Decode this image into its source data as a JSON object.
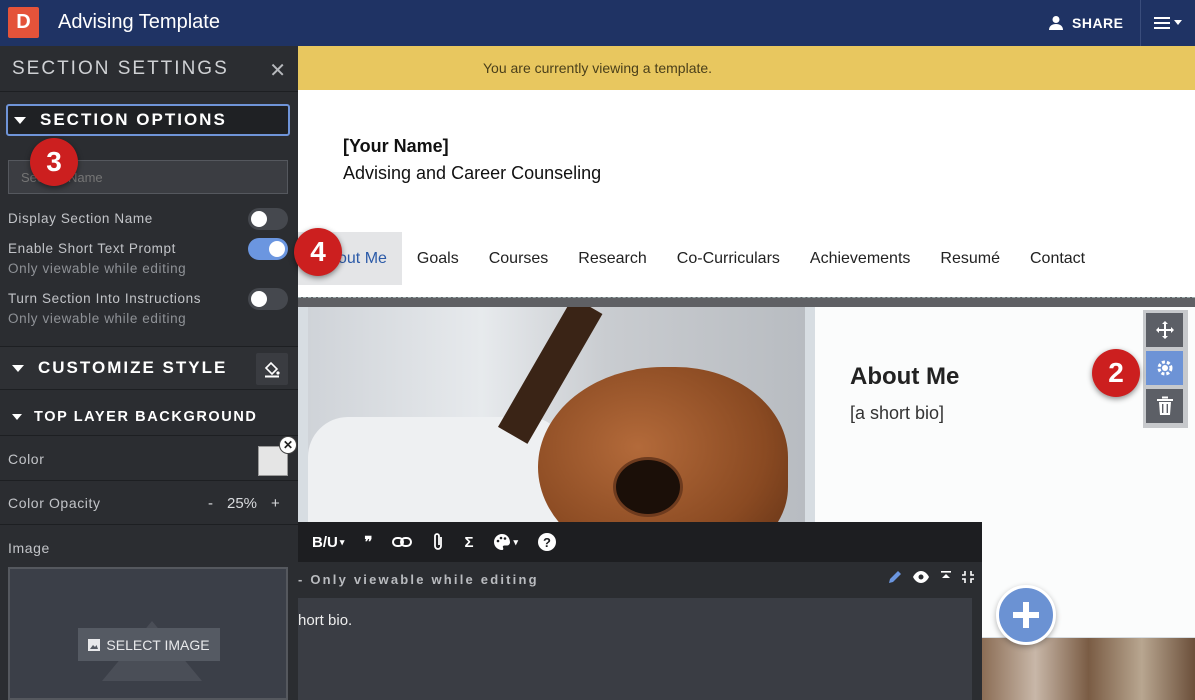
{
  "app": {
    "logo_letter": "D",
    "title": "Advising Template",
    "share_label": "SHARE"
  },
  "panel": {
    "header": "SECTION SETTINGS",
    "section_options": "SECTION OPTIONS",
    "section_name_placeholder": "Section Name",
    "options": [
      {
        "label": "Display Section Name",
        "sub": "",
        "on": false
      },
      {
        "label": "Enable Short Text Prompt",
        "sub": "Only viewable while editing",
        "on": true
      },
      {
        "label": "Turn Section Into Instructions",
        "sub": "Only viewable while editing",
        "on": false
      }
    ],
    "customize_style": "CUSTOMIZE STYLE",
    "top_layer_bg": "TOP LAYER BACKGROUND",
    "color_label": "Color",
    "opacity_label": "Color Opacity",
    "opacity_minus": "-",
    "opacity_value": "25%",
    "opacity_plus": "+",
    "image_label": "Image",
    "select_image": "SELECT IMAGE"
  },
  "banner": "You are currently viewing a template.",
  "site": {
    "name": "[Your Name]",
    "subtitle": "Advising and Career Counseling"
  },
  "nav": [
    "out Me",
    "Goals",
    "Courses",
    "Research",
    "Co-Curriculars",
    "Achievements",
    "Resumé",
    "Contact"
  ],
  "about": {
    "title": "About Me",
    "bio": "[a short bio]"
  },
  "editor": {
    "bold_underline": "B/U",
    "sigma": "Σ",
    "help": "?",
    "header_text": "- Only viewable while editing",
    "body_text": "hort bio."
  },
  "badges": {
    "two": "2",
    "three": "3",
    "four": "4"
  },
  "colors": {
    "topbar": "#1f3364",
    "accent": "#6b96e0",
    "banner": "#e8c75f",
    "badge": "#cc1f1f"
  }
}
